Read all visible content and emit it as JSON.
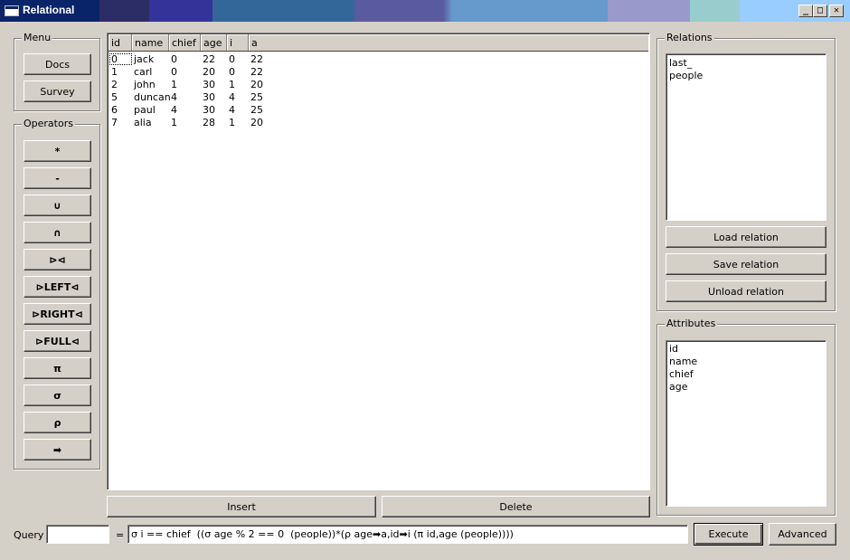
{
  "window": {
    "title": "Relational",
    "controls": {
      "minimize": "_",
      "maximize": "□",
      "close": "✕"
    }
  },
  "menu": {
    "title": "Menu",
    "buttons": [
      "Docs",
      "Survey"
    ]
  },
  "operators": {
    "title": "Operators",
    "buttons": [
      "*",
      "-",
      "∪",
      "∩",
      "⊳⊲",
      "⊳LEFT⊲",
      "⊳RIGHT⊲",
      "⊳FULL⊲",
      "π",
      "σ",
      "ρ",
      "➡"
    ]
  },
  "table": {
    "columns": [
      "id",
      "name",
      "chief",
      "age",
      "i",
      "a"
    ],
    "rows": [
      [
        "0",
        "jack",
        "0",
        "22",
        "0",
        "22"
      ],
      [
        "1",
        "carl",
        "0",
        "20",
        "0",
        "22"
      ],
      [
        "2",
        "john",
        "1",
        "30",
        "1",
        "20"
      ],
      [
        "5",
        "duncan",
        "4",
        "30",
        "4",
        "25"
      ],
      [
        "6",
        "paul",
        "4",
        "30",
        "4",
        "25"
      ],
      [
        "7",
        "alia",
        "1",
        "28",
        "1",
        "20"
      ]
    ]
  },
  "actions": {
    "insert": "Insert",
    "delete": "Delete"
  },
  "relations": {
    "title": "Relations",
    "items": [
      "last_",
      "people"
    ],
    "load": "Load relation",
    "save": "Save relation",
    "unload": "Unload relation"
  },
  "attributes": {
    "title": "Attributes",
    "items": [
      "id",
      "name",
      "chief",
      "age"
    ]
  },
  "query": {
    "label": "Query",
    "name_value": "",
    "equals": "=",
    "expression": "σ i == chief  ((σ age % 2 == 0  (people))*(ρ age➡a,id➡i (π id,age (people))))",
    "execute": "Execute",
    "advanced": "Advanced"
  }
}
